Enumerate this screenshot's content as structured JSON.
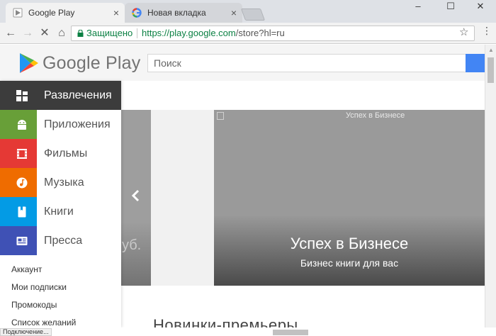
{
  "browser": {
    "tabs": [
      {
        "title": "Google Play",
        "close": "×"
      },
      {
        "title": "Новая вкладка",
        "close": "×"
      }
    ],
    "window_controls": {
      "minimize": "–",
      "maximize": "☐",
      "close": "✕"
    },
    "nav": {
      "back": "←",
      "forward": "→",
      "stop": "✕",
      "home": "⌂"
    },
    "omnibox": {
      "secure_label": "Защищено",
      "url_host": "https://play.google.com",
      "url_path": "/store?hl=ru"
    },
    "star": "☆",
    "menu": "⋮",
    "status_text": "Подключение..."
  },
  "header": {
    "wordmark": "Google Play",
    "search_placeholder": "Поиск"
  },
  "sidebar": {
    "categories": [
      {
        "label": "Развлечения",
        "color": "#3c3c3c",
        "icon": "grid-icon"
      },
      {
        "label": "Приложения",
        "color": "#689f38",
        "icon": "android-icon"
      },
      {
        "label": "Фильмы",
        "color": "#e53935",
        "icon": "film-icon"
      },
      {
        "label": "Музыка",
        "color": "#ef6c00",
        "icon": "music-icon"
      },
      {
        "label": "Книги",
        "color": "#039be5",
        "icon": "book-icon"
      },
      {
        "label": "Пресса",
        "color": "#3f51b5",
        "icon": "newspaper-icon"
      }
    ],
    "links": [
      "Аккаунт",
      "Мои подписки",
      "Промокоды",
      "Список желаний"
    ]
  },
  "carousel": {
    "prev_partial_text": "уб.",
    "main_image_alt": "Успех в Бизнесе",
    "main_title": "Успех в Бизнесе",
    "main_subtitle": "Бизнес книги для вас"
  },
  "section_heading": "Новинки-премьеры"
}
